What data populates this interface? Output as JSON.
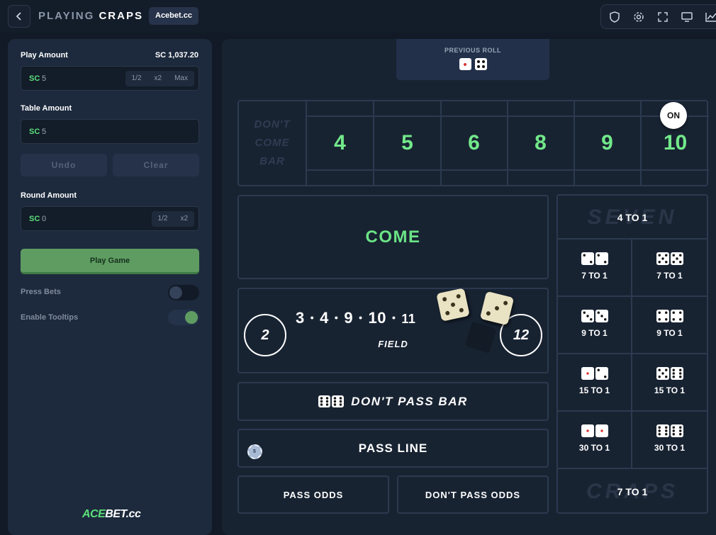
{
  "header": {
    "title_prefix": "PLAYING",
    "title_game": "CRAPS",
    "site_badge": "Acebet.cc"
  },
  "sidebar": {
    "play_amount_label": "Play Amount",
    "balance": "SC 1,037.20",
    "currency": "SC",
    "play_amount_value": "5",
    "play_amount_buttons": [
      "1/2",
      "x2",
      "Max"
    ],
    "table_amount_label": "Table Amount",
    "table_amount_value": "5",
    "undo_label": "Undo",
    "clear_label": "Clear",
    "round_amount_label": "Round Amount",
    "round_amount_value": "0",
    "round_amount_buttons": [
      "1/2",
      "x2"
    ],
    "play_button": "Play Game",
    "press_bets_label": "Press Bets",
    "press_bets_on": false,
    "tooltips_label": "Enable Tooltips",
    "tooltips_on": true,
    "logo_ace": "ACE",
    "logo_rest": "BET.cc"
  },
  "board": {
    "previous_roll_label": "PREVIOUS ROLL",
    "previous_roll": [
      1,
      4
    ],
    "dont_come_bar": [
      "DON'T",
      "COME",
      "BAR"
    ],
    "points": [
      "4",
      "5",
      "6",
      "8",
      "9",
      "10"
    ],
    "on_marker": "ON",
    "on_point": "10",
    "come_label": "COME",
    "field_left": "2",
    "field_right": "12",
    "field_numbers": [
      "3",
      "4",
      "9",
      "10",
      "11"
    ],
    "field_sep": "•",
    "field_label": "FIELD",
    "current_dice": [
      5,
      3
    ],
    "dont_pass_bar_label": "DON'T PASS BAR",
    "pass_line_label": "PASS LINE",
    "pass_line_chip": "5",
    "pass_odds_label": "PASS ODDS",
    "dont_pass_odds_label": "DON'T PASS ODDS",
    "seven_watermark": "SEVEN",
    "seven_payout": "4 TO 1",
    "props": [
      {
        "dice": [
          2,
          2
        ],
        "payout": "7 TO 1"
      },
      {
        "dice": [
          5,
          5
        ],
        "payout": "7 TO 1"
      },
      {
        "dice": [
          3,
          3
        ],
        "payout": "9 TO 1"
      },
      {
        "dice": [
          4,
          4
        ],
        "payout": "9 TO 1"
      },
      {
        "dice": [
          1,
          2
        ],
        "payout": "15 TO 1"
      },
      {
        "dice": [
          5,
          6
        ],
        "payout": "15 TO 1"
      },
      {
        "dice": [
          1,
          1
        ],
        "payout": "30 TO 1"
      },
      {
        "dice": [
          6,
          6
        ],
        "payout": "30 TO 1"
      }
    ],
    "craps_watermark": "CRAPS",
    "craps_payout": "7 TO 1"
  },
  "colors": {
    "accent_green": "#72e98a",
    "play_button": "#5f9c62",
    "panel": "#1d2a3d",
    "background": "#111a26"
  }
}
